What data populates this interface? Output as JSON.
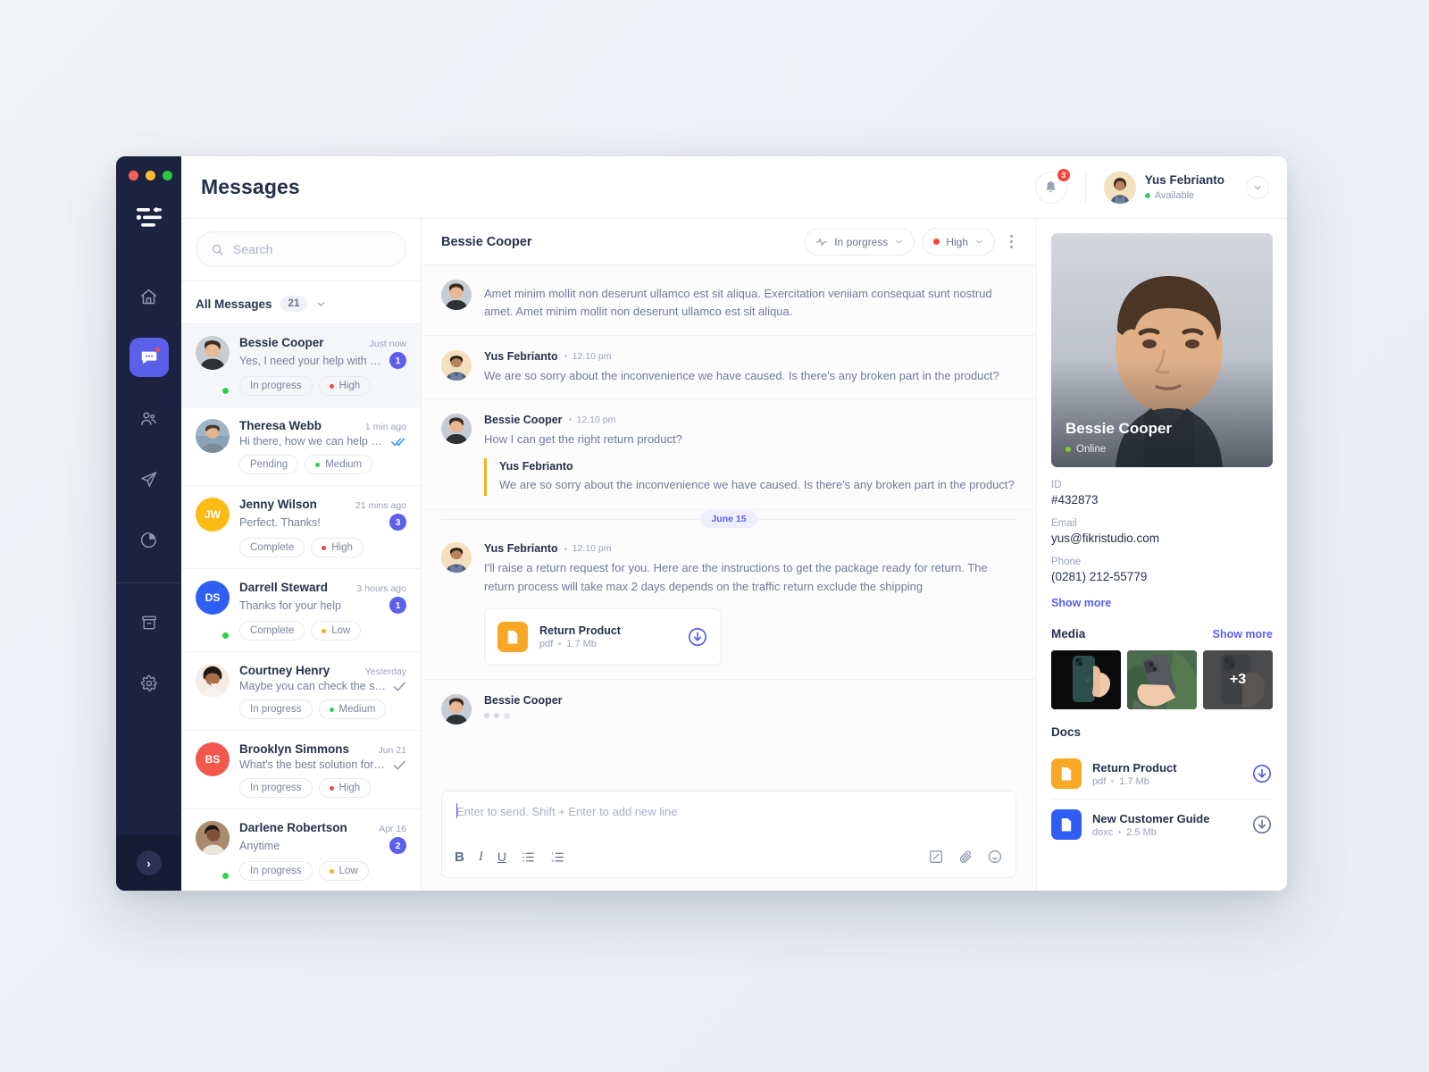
{
  "window": {
    "traffic_lights": [
      "close",
      "minimize",
      "maximize"
    ]
  },
  "rail": {
    "logo": "filter-logo-icon",
    "items": [
      {
        "name": "home",
        "icon": "home-icon",
        "active": false
      },
      {
        "name": "messages",
        "icon": "chat-bubble-icon",
        "active": true,
        "dot": true
      },
      {
        "name": "contacts",
        "icon": "users-icon",
        "active": false
      },
      {
        "name": "send",
        "icon": "paper-plane-icon",
        "active": false
      },
      {
        "name": "analytics",
        "icon": "pie-chart-icon",
        "active": false
      }
    ],
    "bottom_items": [
      {
        "name": "archive",
        "icon": "archive-icon"
      },
      {
        "name": "settings",
        "icon": "gear-icon"
      }
    ],
    "expand_label": "›"
  },
  "topbar": {
    "title": "Messages",
    "notification_count": "3",
    "user": {
      "name": "Yus Febrianto",
      "status": "Available",
      "status_color": "#38c76a"
    }
  },
  "sidebar": {
    "search": {
      "value": "",
      "placeholder": "Search"
    },
    "filter": {
      "label": "All Messages",
      "count": "21"
    },
    "conversations": [
      {
        "name": "Bessie Cooper",
        "time": "Just now",
        "snippet": "Yes, I need your help with my...",
        "unread": "1",
        "tick": "",
        "avatar_type": "photo",
        "avatar_color": "#b8bec9",
        "initials": "",
        "online": true,
        "active": true,
        "tags": [
          {
            "label": "In progress",
            "dot": ""
          },
          {
            "label": "High",
            "dot": "#f4463d"
          }
        ]
      },
      {
        "name": "Theresa Webb",
        "time": "1 min ago",
        "snippet": "Hi there, how we can help you?",
        "unread": "",
        "tick": "double",
        "avatar_type": "photo",
        "avatar_color": "#9fb4c4",
        "initials": "",
        "online": false,
        "active": false,
        "tags": [
          {
            "label": "Pending",
            "dot": ""
          },
          {
            "label": "Medium",
            "dot": "#2bd14f"
          }
        ]
      },
      {
        "name": "Jenny Wilson",
        "time": "21 mins ago",
        "snippet": "Perfect. Thanks!",
        "unread": "3",
        "tick": "",
        "avatar_type": "initials",
        "avatar_color": "#fdbc15",
        "initials": "JW",
        "online": false,
        "active": false,
        "tags": [
          {
            "label": "Complete",
            "dot": ""
          },
          {
            "label": "High",
            "dot": "#f4463d"
          }
        ]
      },
      {
        "name": "Darrell Steward",
        "time": "3 hours ago",
        "snippet": "Thanks for your help",
        "unread": "1",
        "tick": "",
        "avatar_type": "initials",
        "avatar_color": "#2f5ef5",
        "initials": "DS",
        "online": true,
        "active": false,
        "tags": [
          {
            "label": "Complete",
            "dot": ""
          },
          {
            "label": "Low",
            "dot": "#f6b11d"
          }
        ]
      },
      {
        "name": "Courtney Henry",
        "time": "Yesterday",
        "snippet": "Maybe you can check the setti...",
        "unread": "",
        "tick": "single",
        "avatar_type": "photo",
        "avatar_color": "#e8d9cc",
        "initials": "",
        "online": false,
        "active": false,
        "tags": [
          {
            "label": "In progress",
            "dot": ""
          },
          {
            "label": "Medium",
            "dot": "#2bd14f"
          }
        ]
      },
      {
        "name": "Brooklyn Simmons",
        "time": "Jun 21",
        "snippet": "What's the best solution for th...",
        "unread": "",
        "tick": "single",
        "avatar_type": "initials",
        "avatar_color": "#f2574c",
        "initials": "BS",
        "online": false,
        "active": false,
        "tags": [
          {
            "label": "In progress",
            "dot": ""
          },
          {
            "label": "High",
            "dot": "#f4463d"
          }
        ]
      },
      {
        "name": "Darlene Robertson",
        "time": "Apr 16",
        "snippet": "Anytime",
        "unread": "2",
        "tick": "",
        "avatar_type": "photo",
        "avatar_color": "#c9ab93",
        "initials": "",
        "online": true,
        "active": false,
        "tags": [
          {
            "label": "In progress",
            "dot": ""
          },
          {
            "label": "Low",
            "dot": "#f6b11d"
          }
        ]
      }
    ]
  },
  "chat": {
    "title": "Bessie Cooper",
    "status_pill": {
      "label": "In porgress",
      "icon": "activity-pulse-icon"
    },
    "priority_pill": {
      "label": "High",
      "dot_color": "#f4463d"
    },
    "messages": [
      {
        "author": "",
        "time": "",
        "text": "Amet minim mollit non deserunt ullamco est sit aliqua. Exercitation veniiam consequat sunt nostrud amet. Amet minim mollit non deserunt ullamco est sit aliqua.",
        "avatar_color": "#b8bec9"
      },
      {
        "author": "Yus Febrianto",
        "time": "12.10 pm",
        "text": "We are so sorry about the inconvenience we have caused. Is there's any broken part in the product?",
        "avatar_color": "#f0d8a8"
      },
      {
        "author": "Bessie Cooper",
        "time": "12.10 pm",
        "text": "How I can get the right return product?",
        "avatar_color": "#b8bec9",
        "quote": {
          "author": "Yus Febrianto",
          "text": "We are so sorry about the inconvenience we have caused. Is there's any broken part in the product?"
        }
      }
    ],
    "day_separator": "June 15",
    "last_message": {
      "author": "Yus Febrianto",
      "time": "12.10 pm",
      "text": "I'll raise a return request for you. Here are the instructions to get the package ready for return. The return process will take max 2 days depends on the traffic return exclude the shipping",
      "avatar_color": "#f0d8a8",
      "attachment": {
        "name": "Return Product",
        "type": "pdf",
        "size": "1.7 Mb"
      }
    },
    "typing_indicator": {
      "author": "Bessie Cooper",
      "avatar_color": "#b8bec9"
    },
    "composer": {
      "placeholder": "Enter to send. Shift + Enter to add new line",
      "value": "",
      "format_buttons": [
        "B",
        "I",
        "U",
        "bulleted-list",
        "numbered-list"
      ],
      "tools": [
        "note-icon",
        "attachment-icon",
        "emoji-icon"
      ]
    }
  },
  "panel": {
    "profile": {
      "name": "Bessie Cooper",
      "status": "Online"
    },
    "fields": [
      {
        "label": "ID",
        "value": "#432873"
      },
      {
        "label": "Email",
        "value": "yus@fikristudio.com"
      },
      {
        "label": "Phone",
        "value": "(0281) 212-55779"
      }
    ],
    "show_more": "Show more",
    "media": {
      "title": "Media",
      "show_more": "Show more",
      "overflow_label": "+3",
      "thumbs": [
        "iphone-dark",
        "iphone-plants",
        "iphone-overflow"
      ]
    },
    "docs": {
      "title": "Docs",
      "items": [
        {
          "name": "Return Product",
          "type": "pdf",
          "size": "1.7 Mb",
          "color": "#f9a825",
          "download_active": true
        },
        {
          "name": "New Customer Guide",
          "type": "doxc",
          "size": "2.5 Mb",
          "color": "#2f5ef5",
          "download_active": false
        }
      ]
    }
  }
}
